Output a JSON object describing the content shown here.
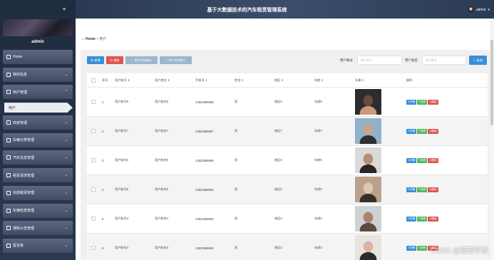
{
  "app": {
    "title": "基于大数据技术的汽车租赁管理系统",
    "user": "admin"
  },
  "sidebar": {
    "admin_name": "admin",
    "items": [
      {
        "label": "Home",
        "icon": "home-icon",
        "expandable": false
      },
      {
        "label": "我的信息",
        "icon": "profile-icon",
        "expandable": true
      },
      {
        "label": "用户管理",
        "icon": "users-icon",
        "expandable": true,
        "expanded": true,
        "children": [
          {
            "label": "用户"
          }
        ]
      },
      {
        "label": "商家管理",
        "icon": "shop-icon",
        "expandable": true
      },
      {
        "label": "车辆分类管理",
        "icon": "category-icon",
        "expandable": true
      },
      {
        "label": "汽车信息管理",
        "icon": "car-icon",
        "expandable": true
      },
      {
        "label": "租赁请求管理",
        "icon": "request-icon",
        "expandable": true
      },
      {
        "label": "完成租赁管理",
        "icon": "complete-icon",
        "expandable": true
      },
      {
        "label": "车辆检查管理",
        "icon": "inspect-icon",
        "expandable": true
      },
      {
        "label": "通知公告管理",
        "icon": "notice-icon",
        "expandable": true
      },
      {
        "label": "留言板",
        "icon": "message-icon",
        "expandable": true
      }
    ]
  },
  "breadcrumb": {
    "home": "Home",
    "sep": "/",
    "current": "用户"
  },
  "toolbar": {
    "add": "新增",
    "delete": "删除",
    "report1": "用户性别统计",
    "report2": "用户性别统计",
    "search_account_label": "用户账号",
    "search_account_placeholder": "用户账号",
    "search_name_label": "用户姓名",
    "search_name_placeholder": "用户姓名",
    "search": "查询"
  },
  "table": {
    "headers": [
      "序号",
      "用户账号 ⇕",
      "用户姓名 ⇕",
      "手机号 ⇕",
      "性别 ⇕",
      "地区 ⇕",
      "年龄 ⇕",
      "头像 ⇕",
      "操作"
    ],
    "actions": {
      "detail": "详情",
      "edit": "修改",
      "delete": "删除"
    },
    "rows": [
      {
        "no": "1",
        "account": "用户账号8",
        "name": "用户姓名8",
        "phone": "13823888888",
        "gender": "男",
        "region": "地区8",
        "age": "年龄8",
        "photo_colors": [
          "#2c2c2c",
          "#c79a7c",
          "#6b4a3a"
        ]
      },
      {
        "no": "2",
        "account": "用户账号7",
        "name": "用户姓名7",
        "phone": "13823888887",
        "gender": "男",
        "region": "地区7",
        "age": "年龄7",
        "photo_colors": [
          "#8fb1c9",
          "#2f2f2f",
          "#c9a58a"
        ]
      },
      {
        "no": "3",
        "account": "用户账号6",
        "name": "用户姓名6",
        "phone": "13823888886",
        "gender": "男",
        "region": "地区6",
        "age": "年龄6",
        "photo_colors": [
          "#d9d9d9",
          "#262626",
          "#b78f76"
        ]
      },
      {
        "no": "4",
        "account": "用户账号5",
        "name": "用户姓名5",
        "phone": "13823888885",
        "gender": "男",
        "region": "地区5",
        "age": "年龄5",
        "photo_colors": [
          "#b9a28c",
          "#3a2d26",
          "#e3c6ad"
        ]
      },
      {
        "no": "5",
        "account": "用户账号4",
        "name": "用户姓名4",
        "phone": "13823888884",
        "gender": "男",
        "region": "地区4",
        "age": "年龄4",
        "photo_colors": [
          "#cfd2d4",
          "#5a4a42",
          "#a88470"
        ]
      },
      {
        "no": "6",
        "account": "用户账号3",
        "name": "用户姓名3",
        "phone": "13823888883",
        "gender": "男",
        "region": "地区3",
        "age": "年龄3",
        "photo_colors": [
          "#e8e3e0",
          "#2b2b2b",
          "#d8b6a2"
        ]
      }
    ]
  },
  "watermark": "CSDN @茄茄学姐",
  "colors": {
    "primary": "#3b8fd8",
    "danger": "#e0554e",
    "success": "#4fb85c",
    "sidebar": "#2a3850"
  }
}
